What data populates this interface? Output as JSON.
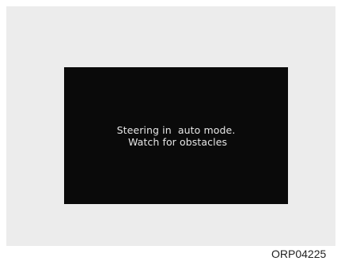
{
  "display": {
    "message_lines": [
      "Steering in  auto mode.",
      " Watch for obstacles"
    ]
  },
  "figure_code": "ORP04225"
}
